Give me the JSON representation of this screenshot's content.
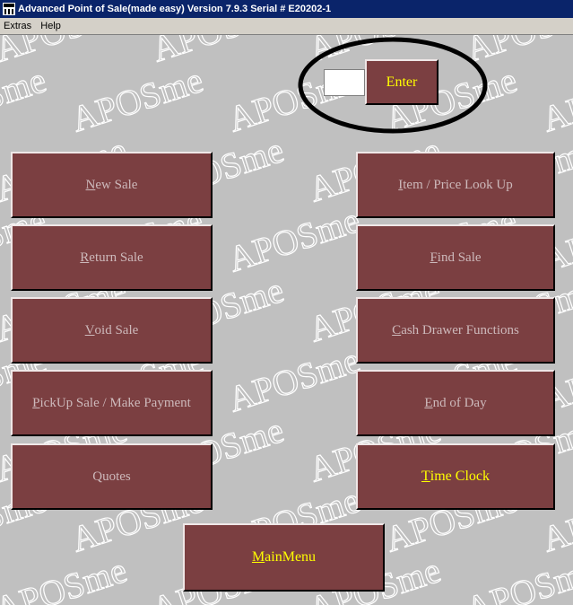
{
  "window": {
    "title": "Advanced Point of Sale(made easy) Version 7.9.3   Serial # E20202-1",
    "icon": "pos-app-icon"
  },
  "menu": [
    {
      "label": "Extras"
    },
    {
      "label": "Help"
    }
  ],
  "entry": {
    "value": "",
    "enter_label": "Enter"
  },
  "buttons": {
    "new_sale": {
      "accel": "N",
      "rest": "ew Sale"
    },
    "return_sale": {
      "accel": "R",
      "rest": "eturn Sale"
    },
    "void_sale": {
      "accel": "V",
      "rest": "oid Sale"
    },
    "pickup_sale": {
      "accel": "P",
      "rest": "ickUp Sale / Make Payment"
    },
    "quotes": {
      "accel": "",
      "rest": "Quotes"
    },
    "item_lookup": {
      "accel": "I",
      "rest": "tem / Price Look Up"
    },
    "find_sale": {
      "accel": "F",
      "rest": "ind Sale"
    },
    "cash_drawer": {
      "accel": "C",
      "rest": "ash Drawer Functions"
    },
    "end_of_day": {
      "accel": "E",
      "rest": "nd of Day"
    },
    "time_clock": {
      "accel": "T",
      "rest": "ime Clock"
    },
    "main_menu": {
      "accel": "M",
      "rest": "ainMenu"
    }
  },
  "watermark_text": "APOSme",
  "colors": {
    "button_face": "#7b3f41",
    "button_text_disabled": "#cdb9bb",
    "button_text_active": "#ffff00",
    "background": "#c0c0c0",
    "titlebar": "#0a246a"
  }
}
